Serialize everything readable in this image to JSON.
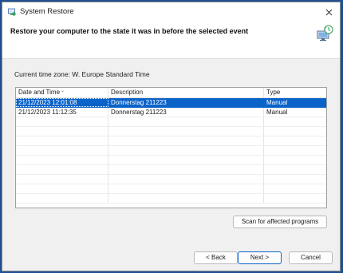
{
  "window": {
    "title": "System Restore",
    "header_title": "Restore your computer to the state it was in before the selected event"
  },
  "timezone_label": "Current time zone: W. Europe Standard Time",
  "table": {
    "columns": [
      "Date and Time",
      "Description",
      "Type"
    ],
    "rows": [
      {
        "date": "21/12/2023 12:01:08",
        "description": "Donnerstag 211223",
        "type": "Manual",
        "selected": true
      },
      {
        "date": "21/12/2023 11:12:35",
        "description": "Donnerstag 211223",
        "type": "Manual",
        "selected": false
      }
    ]
  },
  "buttons": {
    "scan": "Scan for affected programs",
    "back": "< Back",
    "next": "Next >",
    "cancel": "Cancel"
  },
  "icons": {
    "app": "system-restore-icon",
    "close": "close-icon",
    "header": "restore-computer-icon",
    "sort": "sort-arrow-icon"
  },
  "colors": {
    "selection": "#0a63c9",
    "desktop": "#1f4f93"
  }
}
